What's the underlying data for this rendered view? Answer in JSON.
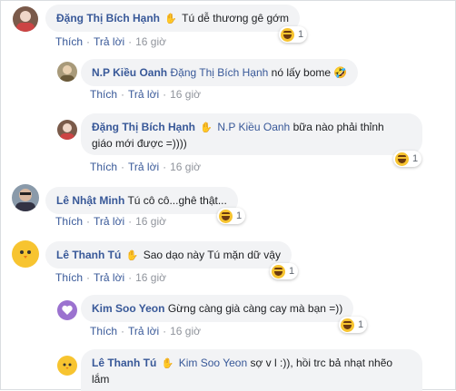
{
  "comments": [
    {
      "name": "Đặng Thị Bích Hạnh",
      "text": "Tú dễ thương gê gớm",
      "actions": {
        "like": "Thích",
        "reply": "Trả lời",
        "time": "16 giờ"
      },
      "reactions": "1"
    },
    {
      "name": "N.P Kiều Oanh",
      "mention": "Đặng Thị Bích Hạnh",
      "text": "nó lấy bome 🤣",
      "actions": {
        "like": "Thích",
        "reply": "Trả lời",
        "time": "16 giờ"
      }
    },
    {
      "name": "Đặng Thị Bích Hạnh",
      "mention": "N.P Kiều Oanh",
      "text_line1": "bữa nào phải thỉnh",
      "text_line2": "giáo mới được =))))",
      "actions": {
        "like": "Thích",
        "reply": "Trả lời",
        "time": "16 giờ"
      },
      "reactions": "1"
    },
    {
      "name": "Lê Nhật Minh",
      "text": "Tú cô cô...ghê thật...",
      "actions": {
        "like": "Thích",
        "reply": "Trả lời",
        "time": "16 giờ"
      },
      "reactions": "1"
    },
    {
      "name": "Lê Thanh Tú",
      "text": "Sao dạo này Tú mặn dữ vậy",
      "actions": {
        "like": "Thích",
        "reply": "Trả lời",
        "time": "16 giờ"
      },
      "reactions": "1"
    },
    {
      "name": "Kim Soo Yeon",
      "text": "Gừng càng già càng cay mà bạn =))",
      "actions": {
        "like": "Thích",
        "reply": "Trả lời",
        "time": "16 giờ"
      },
      "reactions": "1"
    },
    {
      "name": "Lê Thanh Tú",
      "mention": "Kim Soo Yeon",
      "text_line1": "sợ v l :)), hồi trc bả nhạt nhẽo",
      "text_line2": "lắm"
    }
  ],
  "icons": {
    "hand": "waving-hand-icon",
    "reaction": "laughing-emoji-icon"
  }
}
